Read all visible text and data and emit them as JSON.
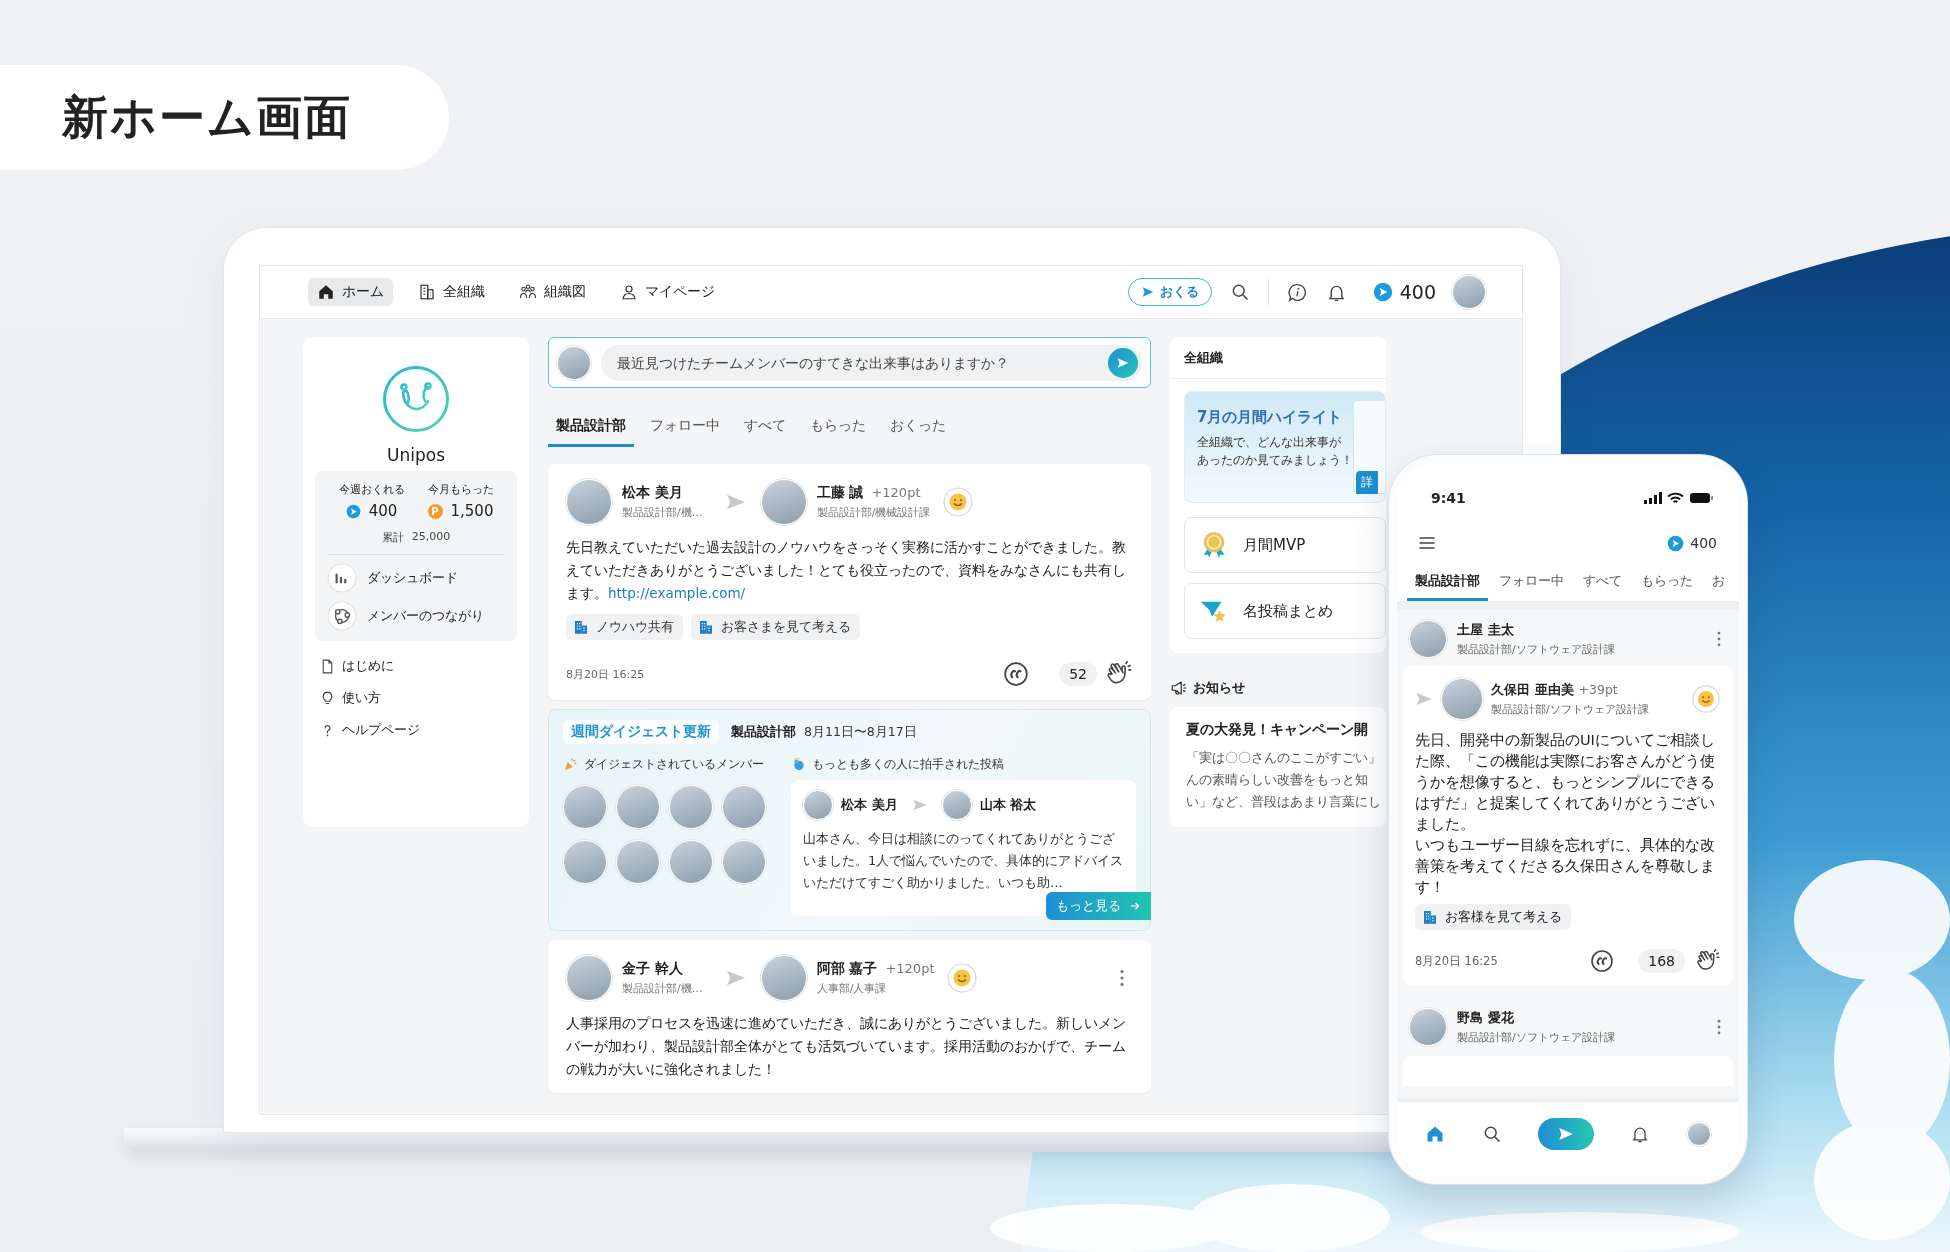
{
  "headline": "新ホーム画面",
  "laptop": {
    "nav": {
      "items": [
        {
          "kind": "home",
          "label": "ホーム",
          "selected": true
        },
        {
          "kind": "org",
          "label": "全組織",
          "selected": false
        },
        {
          "kind": "chart",
          "label": "組織図",
          "selected": false
        },
        {
          "kind": "person",
          "label": "マイページ",
          "selected": false
        }
      ],
      "send_button": "おくる",
      "points": "400"
    },
    "sidebar": {
      "brand": "Unipos",
      "stats": [
        {
          "kind": "send",
          "label": "今週おくれる",
          "value": "400"
        },
        {
          "kind": "coin",
          "label": "今月もらった",
          "value": "1,500",
          "symbol": "P"
        }
      ],
      "total_label": "累計",
      "total_value": "25,000",
      "menu": [
        {
          "kind": "dashboard",
          "label": "ダッシュボード"
        },
        {
          "kind": "network",
          "label": "メンバーのつながり"
        }
      ],
      "links": [
        {
          "kind": "doc",
          "label": "はじめに"
        },
        {
          "kind": "bulb",
          "label": "使い方"
        },
        {
          "kind": "help",
          "label": "ヘルプページ"
        }
      ]
    },
    "composer": {
      "placeholder": "最近見つけたチームメンバーのすてきな出来事はありますか？"
    },
    "tabs": [
      {
        "label": "製品設計部",
        "selected": true
      },
      {
        "label": "フォロー中",
        "selected": false
      },
      {
        "label": "すべて",
        "selected": false
      },
      {
        "label": "もらった",
        "selected": false
      },
      {
        "label": "おくった",
        "selected": false
      }
    ],
    "feed": [
      {
        "kind": "post",
        "more_menu": false,
        "sender": {
          "name": "松本 美月",
          "dept": "製品設計部/機…"
        },
        "receiver": {
          "name": "工藤 誠",
          "dept": "製品設計部/機械設計課"
        },
        "points": "+120pt",
        "body": "先日教えていただいた過去設計のノウハウをさっそく実務に活かすことができました。教えていただきありがとうございました！とても役立ったので、資料をみなさんにも共有します。",
        "link": "http://example.com/",
        "tags": [
          "ノウハウ共有",
          "お客さまを見て考える"
        ],
        "time": "8月20日 16:25",
        "claps": "52"
      },
      {
        "kind": "digest",
        "badge": "週間ダイジェスト更新",
        "team": "製品設計部",
        "period": "8月11日〜8月17日",
        "members_label": "ダイジェストされているメンバー",
        "top_label": "もっとも多くの人に拍手された投稿",
        "top_post": {
          "sender": "松本 美月",
          "receiver": "山本 裕太",
          "body": "山本さん、今日は相談にのってくれてありがとうございました。1人で悩んでいたので、具体的にアドバイスいただけてすごく助かりました。いつも助…"
        },
        "more_button": "もっと見る"
      },
      {
        "kind": "post",
        "more_menu": true,
        "sender": {
          "name": "金子 幹人",
          "dept": "製品設計部/機…"
        },
        "receiver": {
          "name": "阿部 嘉子",
          "dept": "人事部/人事課"
        },
        "points": "+120pt",
        "body": "人事採用のプロセスを迅速に進めていただき、誠にありがとうございました。新しいメンバーが加わり、製品設計部全体がとても活気づいています。採用活動のおかげで、チームの戦力が大いに強化されました！"
      }
    ],
    "right": {
      "title": "全組織",
      "banner": {
        "title": "7月の月間ハイライト",
        "text_lines": [
          "全組織で、どんな出来事が",
          "あったのか見てみましょう！"
        ],
        "button": "詳"
      },
      "cards": [
        {
          "kind": "medal",
          "label": "月間MVP"
        },
        {
          "kind": "star",
          "label": "名投稿まとめ"
        }
      ],
      "notice": {
        "heading": "お知らせ",
        "title": "夏の大発見！キャンペーン開",
        "lines": [
          "「実は〇〇さんのここがすごい」",
          "んの素晴らしい改善をもっと知",
          "い」など、普段はあまり言葉にし"
        ]
      }
    }
  },
  "phone": {
    "time": "9:41",
    "points": "400",
    "tabs": [
      {
        "label": "製品設計部",
        "selected": true
      },
      {
        "label": "フォロー中",
        "selected": false
      },
      {
        "label": "すべて",
        "selected": false
      },
      {
        "label": "もらった",
        "selected": false
      },
      {
        "label": "お",
        "selected": false
      }
    ],
    "posts": [
      {
        "sender": {
          "name": "土屋 圭太",
          "dept": "製品設計部/ソフトウェア設計課"
        },
        "message": {
          "receiver": {
            "name": "久保田 亜由美",
            "dept": "製品設計部/ソフトウェア設計課"
          },
          "points": "+39pt",
          "paragraphs": [
            "先日、開発中の新製品のUIについてご相談した際、「この機能は実際にお客さんがどう使うかを想像すると、もっとシンプルにできるはずだ」と提案してくれてありがとうございました。",
            "いつもユーザー目線を忘れずに、具体的な改善策を考えてくださる久保田さんを尊敬します！"
          ],
          "tags": [
            "お客様を見て考える"
          ],
          "time": "8月20日 16:25",
          "claps": "168"
        }
      },
      {
        "sender": {
          "name": "野島 愛花",
          "dept": "製品設計部/ソフトウェア設計課"
        }
      }
    ],
    "bottom_nav": [
      {
        "kind": "home",
        "selected": true
      },
      {
        "kind": "search",
        "selected": false
      },
      {
        "kind": "send",
        "selected": false
      },
      {
        "kind": "bell",
        "selected": false
      },
      {
        "kind": "profile",
        "selected": false
      }
    ]
  }
}
